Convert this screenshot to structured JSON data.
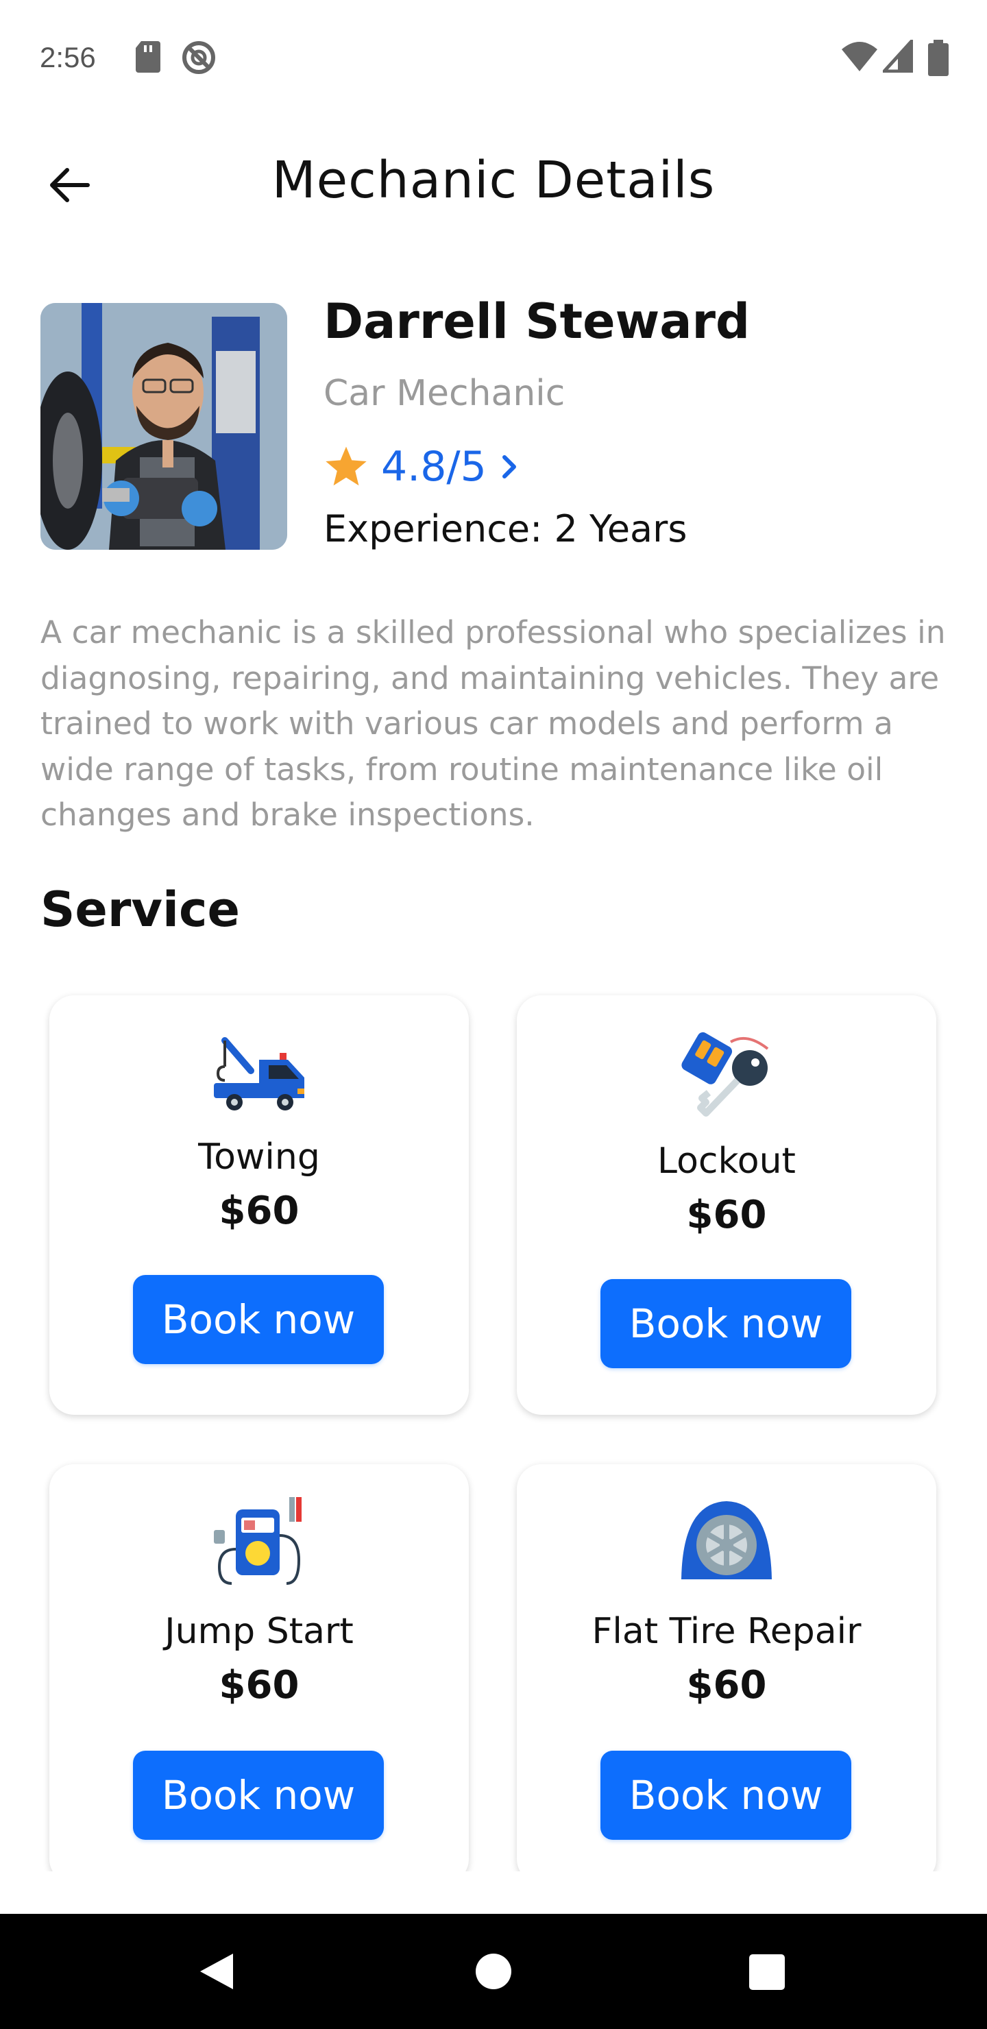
{
  "status_bar": {
    "time": "2:56",
    "left_icons": [
      "sd-card-icon",
      "do-not-disturb-icon"
    ],
    "right_icons": [
      "wifi-icon",
      "cell-signal-icon",
      "battery-icon"
    ]
  },
  "app_bar": {
    "title": "Mechanic Details",
    "back_icon": "arrow-left-icon"
  },
  "profile": {
    "name": "Darrell Steward",
    "role": "Car Mechanic",
    "rating": "4.8/5",
    "experience": "Experience: 2 Years"
  },
  "description": "A car mechanic is a skilled professional who specializes in diagnosing, repairing, and maintaining vehicles. They are trained to work with various car models and perform a wide range of tasks, from routine maintenance like oil changes and brake inspections.",
  "services": {
    "heading": "Service",
    "items": [
      {
        "name": "Towing",
        "price": "$60",
        "button": "Book now",
        "icon": "tow-truck-icon"
      },
      {
        "name": "Lockout",
        "price": "$60",
        "button": "Book now",
        "icon": "car-key-icon"
      },
      {
        "name": "Jump Start",
        "price": "$60",
        "button": "Book now",
        "icon": "jump-starter-icon"
      },
      {
        "name": "Flat Tire Repair",
        "price": "$60",
        "button": "Book now",
        "icon": "flat-tire-icon"
      }
    ]
  },
  "colors": {
    "accent": "#0D6EFD",
    "rating_text": "#1A66E8",
    "star": "#F7A531",
    "muted_text": "#9A9A9A"
  }
}
